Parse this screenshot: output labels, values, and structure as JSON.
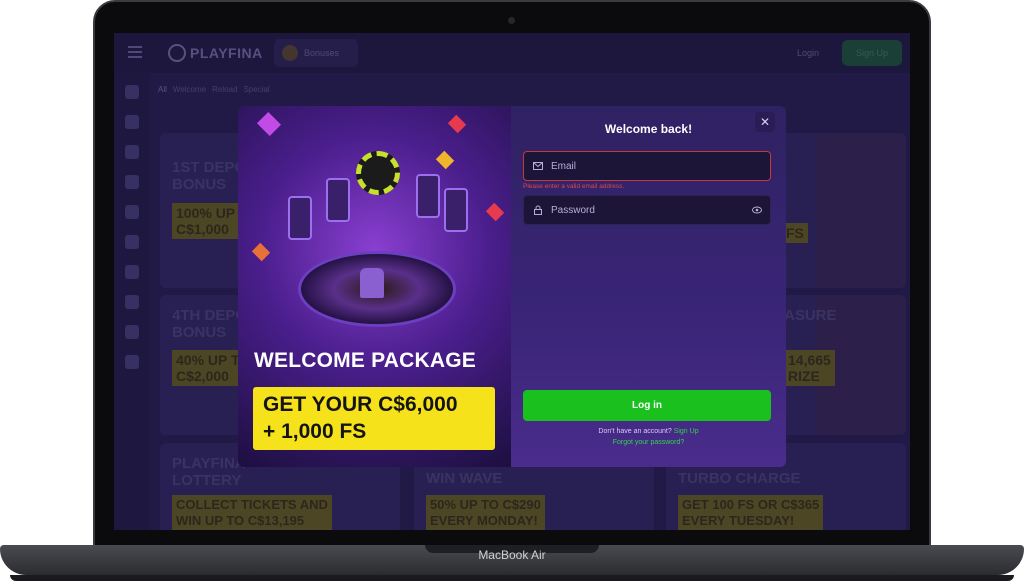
{
  "device": {
    "model_label": "MacBook Air"
  },
  "site": {
    "logo_text": "PLAYFINA",
    "nav": {
      "bonuses": "Bonuses",
      "login": "Login",
      "signup": "Sign Up"
    },
    "filters": [
      "All",
      "Welcome",
      "Reload",
      "Special"
    ],
    "cards": [
      {
        "title": "1ST DEPO\nBONUS",
        "tag": "100% UP\nC$1,000"
      },
      {
        "title": "4TH DEPO\nBONUS",
        "tag": "40% UP T\nC$2,000"
      },
      {
        "title": "PLAYFINA\nLOTTERY",
        "tag": "COLLECT TICKETS AND\nWIN UP TO C$13,195"
      },
      {
        "title": "WIN WAVE",
        "tag": "50% UP TO C$290\nEVERY MONDAY!"
      },
      {
        "title": "TURBO CHARGE",
        "tag": "GET 100 FS OR C$365\nEVERY TUESDAY!"
      },
      {
        "title": "ASURE",
        "tag": "14,665\nRIZE"
      },
      {
        "title": "",
        "tag": "FS"
      }
    ]
  },
  "modal": {
    "promo_title": "WELCOME PACKAGE",
    "promo_offer_line1": "GET YOUR C$6,000",
    "promo_offer_line2": "+ 1,000 FS",
    "close_symbol": "✕",
    "title": "Welcome back!",
    "email_placeholder": "Email",
    "email_error": "Please enter a valid email address.",
    "password_placeholder": "Password",
    "submit_label": "Log in",
    "no_account_text": "Don't have an account?",
    "signup_link": "Sign Up",
    "forgot_link": "Forgot your password?"
  },
  "colors": {
    "accent_green": "#19c01e",
    "error_red": "#e04646",
    "promo_yellow": "#f6e21a",
    "modal_purple": "#3a2578"
  },
  "icons": [
    "menu-icon",
    "logo-mark-icon",
    "bonuses-icon",
    "mail-icon",
    "lock-icon",
    "eye-icon",
    "close-icon"
  ]
}
